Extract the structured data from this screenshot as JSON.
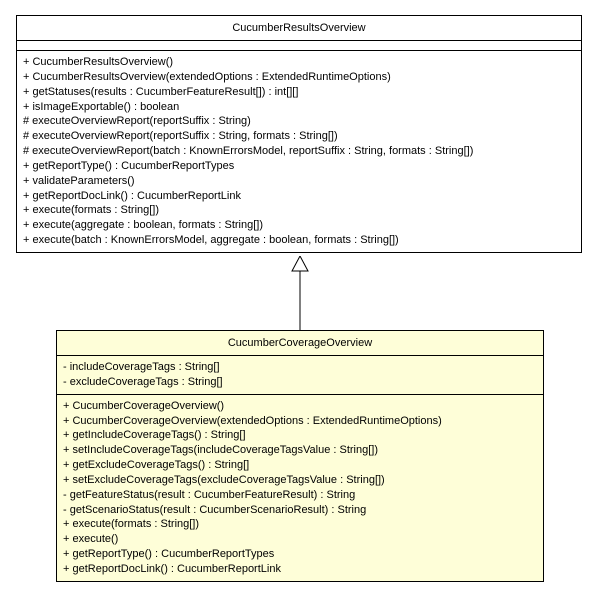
{
  "chart_data": {
    "type": "uml_class_diagram",
    "classes": [
      {
        "name": "CucumberResultsOverview",
        "highlighted": false,
        "attributes": [],
        "operations": [
          "+ CucumberResultsOverview()",
          "+ CucumberResultsOverview(extendedOptions : ExtendedRuntimeOptions)",
          "+ getStatuses(results : CucumberFeatureResult[]) : int[][]",
          "+ isImageExportable() : boolean",
          "# executeOverviewReport(reportSuffix : String)",
          "# executeOverviewReport(reportSuffix : String, formats : String[])",
          "# executeOverviewReport(batch : KnownErrorsModel, reportSuffix : String, formats : String[])",
          "+ getReportType() : CucumberReportTypes",
          "+ validateParameters()",
          "+ getReportDocLink() : CucumberReportLink",
          "+ execute(formats : String[])",
          "+ execute(aggregate : boolean, formats : String[])",
          "+ execute(batch : KnownErrorsModel, aggregate : boolean, formats : String[])"
        ]
      },
      {
        "name": "CucumberCoverageOverview",
        "highlighted": true,
        "attributes": [
          "- includeCoverageTags : String[]",
          "- excludeCoverageTags : String[]"
        ],
        "operations": [
          "+ CucumberCoverageOverview()",
          "+ CucumberCoverageOverview(extendedOptions : ExtendedRuntimeOptions)",
          "+ getIncludeCoverageTags() : String[]",
          "+ setIncludeCoverageTags(includeCoverageTagsValue : String[])",
          "+ getExcludeCoverageTags() : String[]",
          "+ setExcludeCoverageTags(excludeCoverageTagsValue : String[])",
          "- getFeatureStatus(result : CucumberFeatureResult) : String",
          "- getScenarioStatus(result : CucumberScenarioResult) : String",
          "+ execute(formats : String[])",
          "+ execute()",
          "+ getReportType() : CucumberReportTypes",
          "+ getReportDocLink() : CucumberReportLink"
        ]
      }
    ],
    "relationships": [
      {
        "type": "generalization",
        "from": "CucumberCoverageOverview",
        "to": "CucumberResultsOverview"
      }
    ]
  }
}
